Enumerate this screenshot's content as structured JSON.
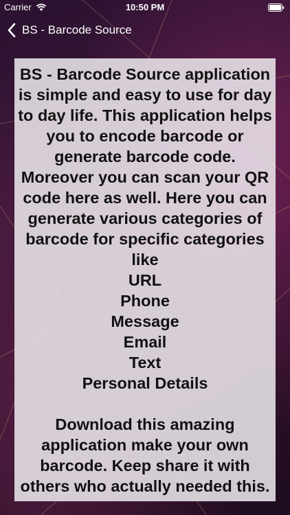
{
  "status_bar": {
    "carrier": "Carrier",
    "time": "10:50 PM",
    "wifi_icon": "wifi-icon",
    "battery_icon": "battery-icon"
  },
  "nav": {
    "back_icon": "chevron-left-icon",
    "title": "BS - Barcode Source"
  },
  "content": {
    "description": "BS - Barcode Source application is simple and easy to use for day to day life. This application helps you to encode barcode or generate barcode code. Moreover you can scan your QR code here as well. Here you can generate various categories of barcode for specific categories like\nURL\nPhone\nMessage\nEmail\nText\nPersonal Details\n\nDownload this amazing application make your own barcode. Keep share it with others who actually needed this."
  },
  "colors": {
    "panel_background": "#ebe6ec",
    "text": "#111111",
    "nav_text": "#ffffff"
  }
}
